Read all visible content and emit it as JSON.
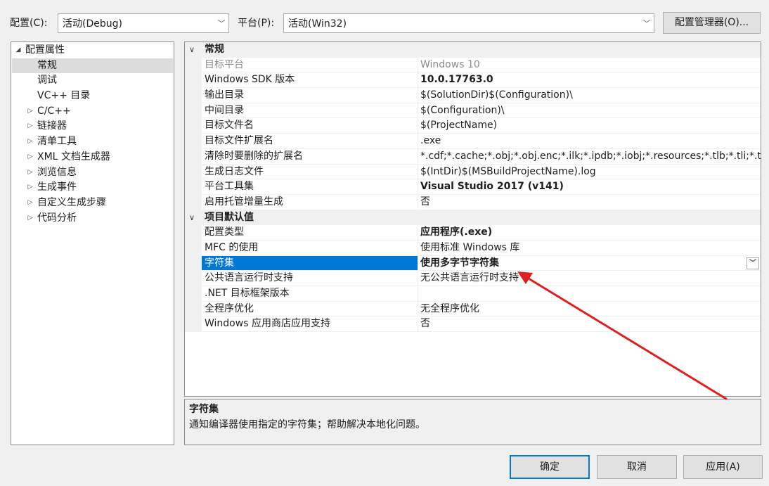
{
  "toolbar": {
    "config_label": "配置(C):",
    "config_value": "活动(Debug)",
    "platform_label": "平台(P):",
    "platform_value": "活动(Win32)",
    "config_manager_button": "配置管理器(O)..."
  },
  "tree": {
    "items": [
      {
        "label": "配置属性",
        "twisty": "◢",
        "level": 0
      },
      {
        "label": "常规",
        "twisty": "",
        "level": 1,
        "selected": true
      },
      {
        "label": "调试",
        "twisty": "",
        "level": 1
      },
      {
        "label": "VC++ 目录",
        "twisty": "",
        "level": 1
      },
      {
        "label": "C/C++",
        "twisty": "▷",
        "level": 1
      },
      {
        "label": "链接器",
        "twisty": "▷",
        "level": 1
      },
      {
        "label": "清单工具",
        "twisty": "▷",
        "level": 1
      },
      {
        "label": "XML 文档生成器",
        "twisty": "▷",
        "level": 1
      },
      {
        "label": "浏览信息",
        "twisty": "▷",
        "level": 1
      },
      {
        "label": "生成事件",
        "twisty": "▷",
        "level": 1
      },
      {
        "label": "自定义生成步骤",
        "twisty": "▷",
        "level": 1
      },
      {
        "label": "代码分析",
        "twisty": "▷",
        "level": 1
      }
    ]
  },
  "grid": {
    "rows": [
      {
        "type": "cat",
        "name": "常规"
      },
      {
        "type": "prop",
        "name": "目标平台",
        "value": "Windows 10",
        "style": "disabled"
      },
      {
        "type": "prop",
        "name": "Windows SDK 版本",
        "value": "10.0.17763.0",
        "style": "bold"
      },
      {
        "type": "prop",
        "name": "输出目录",
        "value": "$(SolutionDir)$(Configuration)\\"
      },
      {
        "type": "prop",
        "name": "中间目录",
        "value": "$(Configuration)\\"
      },
      {
        "type": "prop",
        "name": "目标文件名",
        "value": "$(ProjectName)"
      },
      {
        "type": "prop",
        "name": "目标文件扩展名",
        "value": ".exe"
      },
      {
        "type": "prop",
        "name": "清除时要删除的扩展名",
        "value": "*.cdf;*.cache;*.obj;*.obj.enc;*.ilk;*.ipdb;*.iobj;*.resources;*.tlb;*.tli;*.tlh;*.t"
      },
      {
        "type": "prop",
        "name": "生成日志文件",
        "value": "$(IntDir)$(MSBuildProjectName).log"
      },
      {
        "type": "prop",
        "name": "平台工具集",
        "value": "Visual Studio 2017 (v141)",
        "style": "bold"
      },
      {
        "type": "prop",
        "name": "启用托管增量生成",
        "value": "否"
      },
      {
        "type": "cat",
        "name": "项目默认值"
      },
      {
        "type": "prop",
        "name": "配置类型",
        "value": "应用程序(.exe)",
        "style": "bold"
      },
      {
        "type": "prop",
        "name": "MFC 的使用",
        "value": "使用标准 Windows 库"
      },
      {
        "type": "prop",
        "name": "字符集",
        "value": "使用多字节字符集",
        "style": "sel"
      },
      {
        "type": "prop",
        "name": "公共语言运行时支持",
        "value": "无公共语言运行时支持"
      },
      {
        "type": "prop",
        "name": ".NET 目标框架版本",
        "value": ""
      },
      {
        "type": "prop",
        "name": "全程序优化",
        "value": "无全程序优化"
      },
      {
        "type": "prop",
        "name": "Windows 应用商店应用支持",
        "value": "否"
      }
    ]
  },
  "description": {
    "title": "字符集",
    "text": "通知编译器使用指定的字符集；帮助解决本地化问题。"
  },
  "buttons": {
    "ok": "确定",
    "cancel": "取消",
    "apply": "应用(A)"
  },
  "colors": {
    "selection": "#0078d7",
    "annotation_arrow": "#e02020"
  },
  "icons": {
    "combo_arrow": "﹀",
    "dropdown_arrow": "﹀"
  }
}
